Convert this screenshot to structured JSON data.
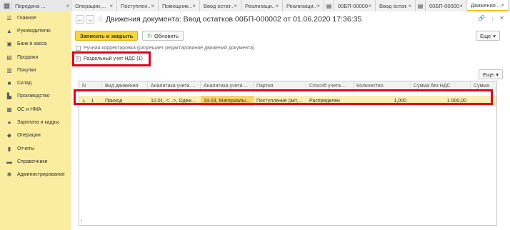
{
  "top_tabs": [
    {
      "label": "Передача ...",
      "active": false
    },
    {
      "label": "Операции,...",
      "active": false
    },
    {
      "label": "Поступлен...",
      "active": false
    },
    {
      "label": "Помощник...",
      "active": false
    },
    {
      "label": "Ввод остат...",
      "active": false
    },
    {
      "label": "Реализаци...",
      "active": false
    },
    {
      "label": "Реализаци...",
      "active": false
    },
    {
      "label": "00БП-000003",
      "active": false
    },
    {
      "label": "Ввод остат...",
      "active": false
    },
    {
      "label": "00БП-000002",
      "active": false
    },
    {
      "label": "Движения ...",
      "active": true
    }
  ],
  "tab_close": "×",
  "sidebar": {
    "items": [
      {
        "label": "Главное",
        "icon": "menu-icon"
      },
      {
        "label": "Руководителю",
        "icon": "chart-icon"
      },
      {
        "label": "Банк и касса",
        "icon": "bank-icon"
      },
      {
        "label": "Продажи",
        "icon": "cart-icon"
      },
      {
        "label": "Покупки",
        "icon": "basket-icon"
      },
      {
        "label": "Склад",
        "icon": "warehouse-icon"
      },
      {
        "label": "Производство",
        "icon": "factory-icon"
      },
      {
        "label": "ОС и НМА",
        "icon": "assets-icon"
      },
      {
        "label": "Зарплата и кадры",
        "icon": "people-icon"
      },
      {
        "label": "Операции",
        "icon": "operations-icon"
      },
      {
        "label": "Отчеты",
        "icon": "reports-icon"
      },
      {
        "label": "Справочники",
        "icon": "book-icon"
      },
      {
        "label": "Администрирование",
        "icon": "gear-icon"
      }
    ]
  },
  "header": {
    "title": "Движения документа: Ввод остатков 00БП-000002 от 01.06.2020 17:36:35"
  },
  "toolbar": {
    "save_close_label": "Записать и закрыть",
    "refresh_label": "Обновить",
    "more_label": "Еще"
  },
  "manual_correction": {
    "label": "Ручная корректировка (разрешает редактирование движений документа)",
    "checked": false
  },
  "vat_tab": {
    "label": "Раздельный учет НДС (1)",
    "checked": true
  },
  "table": {
    "more_label": "Еще",
    "columns": [
      "N",
      "Вид движения",
      "Аналитика учета ...",
      "Аналитика учета ...",
      "Партия",
      "Способ учета ...",
      "Количество",
      "Сумма без НДС",
      "Сумма"
    ],
    "rows": [
      {
        "marker": "+",
        "n": "1",
        "movement": "Приход",
        "analytics1": "10.01, <...>, Одеж...",
        "analytics2": "19.03, Материалы...",
        "batch": "Поступление (акт,...",
        "method": "Распределен",
        "qty": "1,000",
        "sum_no_vat": "1 000,00",
        "sum": ""
      }
    ]
  },
  "colors": {
    "sidebar_bg": "#fbeda0",
    "accent": "#f9d73a",
    "highlight": "#e4001b",
    "row_bg": "#fbefb6"
  }
}
